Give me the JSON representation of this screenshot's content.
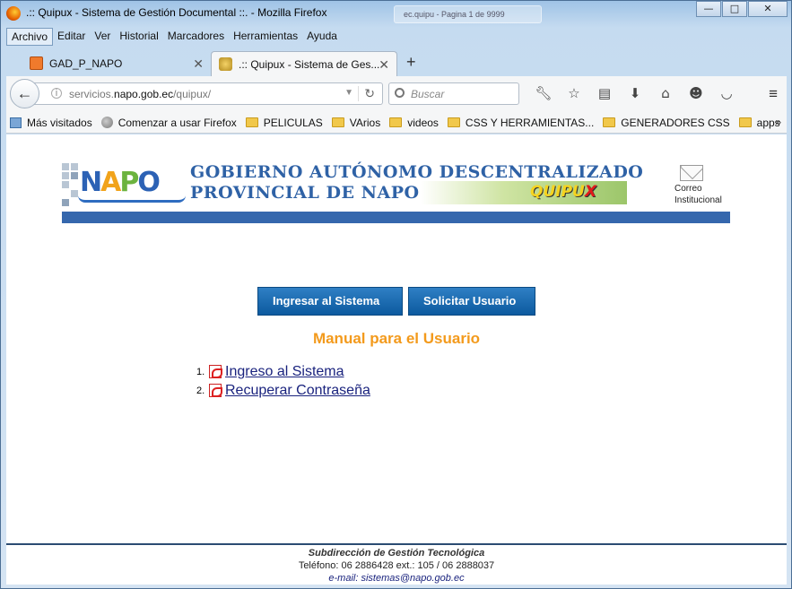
{
  "window": {
    "title": ".:: Quipux - Sistema de Gestión Documental ::. - Mozilla Firefox",
    "ghost_tab_text": "ec.quipu - Pagina 1 de 9999",
    "controls": {
      "minimize": "—",
      "maximize": "□",
      "close": "✕"
    }
  },
  "menu": [
    "Archivo",
    "Editar",
    "Ver",
    "Historial",
    "Marcadores",
    "Herramientas",
    "Ayuda"
  ],
  "tabs": [
    {
      "label": "GAD_P_NAPO",
      "close": "✕"
    },
    {
      "label": ".:: Quipux - Sistema de Ges...",
      "close": "✕"
    }
  ],
  "new_tab": "+",
  "nav": {
    "back": "←",
    "url_prefix": "servicios.",
    "url_host": "napo.gob.ec",
    "url_path": "/quipux/",
    "reload": "↻",
    "search_placeholder": "Buscar",
    "menu": "≡",
    "icons": [
      "wrench-icon",
      "star-icon",
      "clipboard-icon",
      "download-icon",
      "home-icon",
      "smiley-icon",
      "pocket-icon"
    ]
  },
  "bookmarks": [
    {
      "label": "Más visitados",
      "icon": "most-visited-icon"
    },
    {
      "label": "Comenzar a usar Firefox",
      "icon": "globe-icon"
    },
    {
      "label": "PELICULAS",
      "icon": "folder-icon"
    },
    {
      "label": "VArios",
      "icon": "folder-icon"
    },
    {
      "label": "videos",
      "icon": "folder-icon"
    },
    {
      "label": "CSS Y HERRAMIENTAS...",
      "icon": "folder-icon"
    },
    {
      "label": "GENERADORES CSS",
      "icon": "folder-icon"
    },
    {
      "label": "apps",
      "icon": "folder-icon"
    }
  ],
  "bookmarks_more": "»",
  "page": {
    "logo": {
      "n": "N",
      "a": "A",
      "p": "P",
      "o": "O"
    },
    "banner_line1": "GOBIERNO AUTÓNOMO DESCENTRALIZADO",
    "banner_line2": "PROVINCIAL DE NAPO",
    "quipux_main": "QUIPU",
    "quipux_x": "X",
    "mail_line1": "Correo",
    "mail_line2": "Institucional",
    "buttons": {
      "login": "Ingresar al Sistema",
      "request": "Solicitar Usuario"
    },
    "manual_title": "Manual para el Usuario",
    "manual_items": [
      {
        "num": "1.",
        "label": "Ingreso al Sistema"
      },
      {
        "num": "2.",
        "label": "Recuperar Contraseña"
      }
    ],
    "footer": {
      "line1": "Subdirección de Gestión Tecnológica",
      "line2": "Teléfono: 06 2886428 ext.: 105 /  06 2888037",
      "line3": "e-mail: sistemas@napo.gob.ec"
    }
  },
  "colors": {
    "button_blue": "#0c5a9f",
    "banner_bar": "#3567ad",
    "manual_orange": "#f39a1c",
    "link_navy": "#1a237e"
  }
}
